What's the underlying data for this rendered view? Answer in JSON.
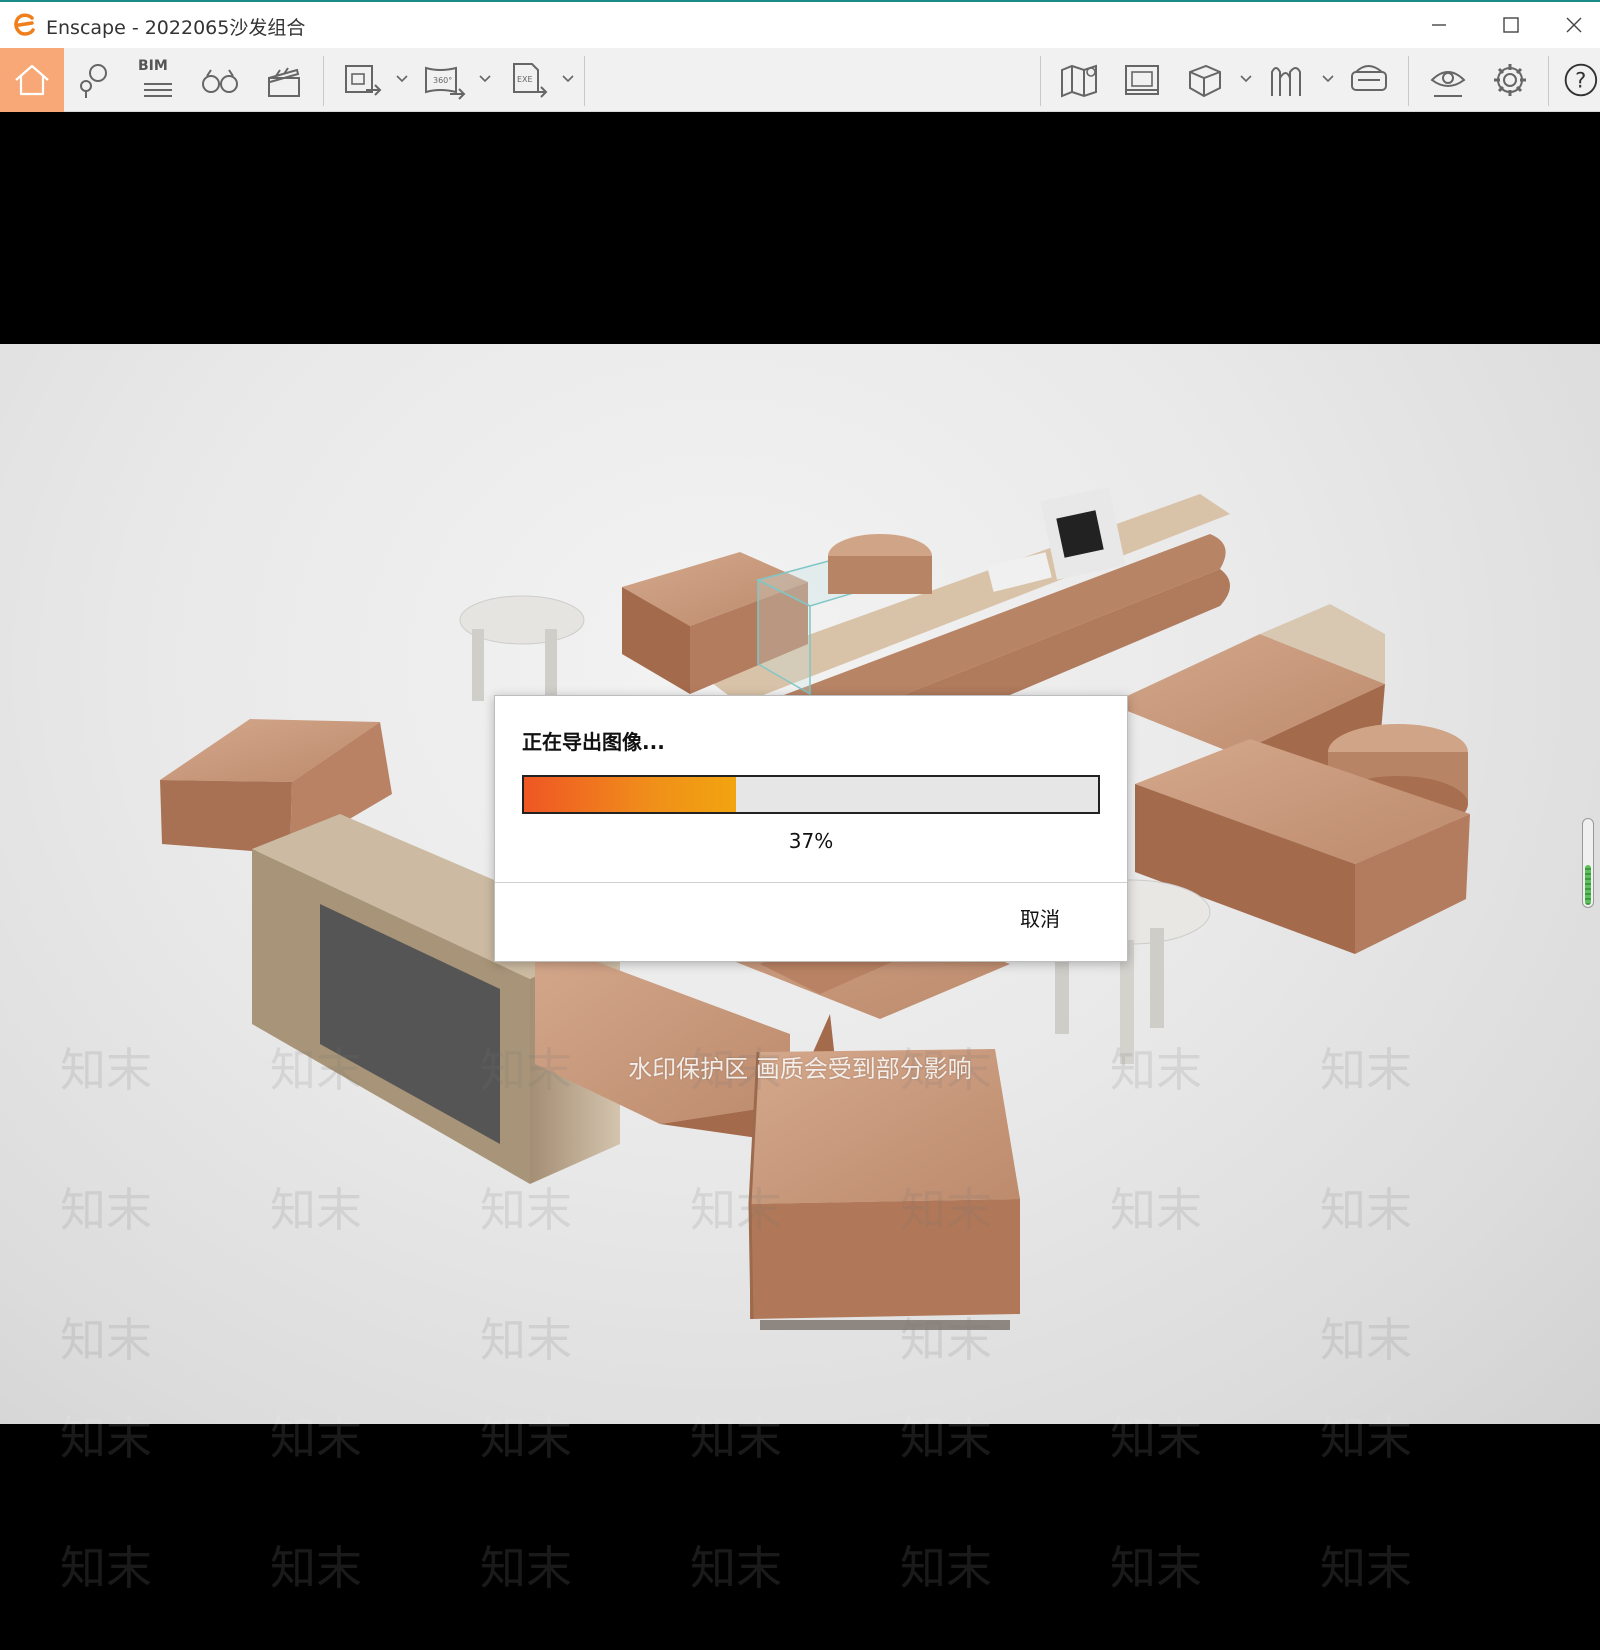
{
  "window": {
    "app_name": "Enscape",
    "title": "Enscape - 2022065沙发组合",
    "controls": [
      "minimize-icon",
      "maximize-icon",
      "close-icon"
    ]
  },
  "toolbar": {
    "left": [
      {
        "name": "home-icon",
        "active": true
      },
      {
        "name": "location-pin-icon"
      },
      {
        "name": "bim-icon",
        "label": "BIM"
      },
      {
        "name": "binoculars-icon"
      },
      {
        "name": "clapperboard-icon"
      }
    ],
    "export": [
      {
        "name": "export-image-icon",
        "dropdown": true
      },
      {
        "name": "export-panorama-icon",
        "label": "360°",
        "dropdown": true
      },
      {
        "name": "export-exe-icon",
        "label": "EXE",
        "dropdown": true
      }
    ],
    "right": [
      {
        "name": "map-icon"
      },
      {
        "name": "asset-library-icon"
      },
      {
        "name": "cube-icon",
        "dropdown": true
      },
      {
        "name": "collaborate-icon",
        "dropdown": true
      },
      {
        "name": "vr-headset-icon"
      },
      {
        "name": "eye-settings-icon"
      },
      {
        "name": "gear-icon"
      },
      {
        "name": "help-icon",
        "label": "?"
      }
    ],
    "accent_color": "#f7a876"
  },
  "watermark": {
    "band_text": "水印保护区  画质会受到部分影响",
    "tile_text": "知末"
  },
  "dialog": {
    "message": "正在导出图像...",
    "progress": 0.37,
    "progress_label": "37%",
    "cancel_label": "取消",
    "progress_colors": [
      "#ef5624",
      "#f2a40f"
    ]
  }
}
